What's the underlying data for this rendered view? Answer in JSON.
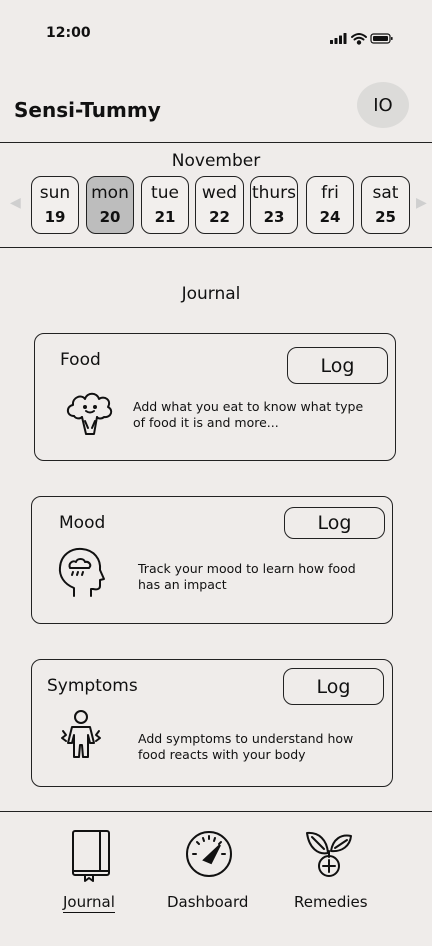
{
  "status": {
    "time": "12:00"
  },
  "header": {
    "title": "Sensi-Tummy",
    "avatar_initials": "IO"
  },
  "calendar": {
    "month": "November",
    "days": [
      {
        "name": "sun",
        "num": "19"
      },
      {
        "name": "mon",
        "num": "20"
      },
      {
        "name": "tue",
        "num": "21"
      },
      {
        "name": "wed",
        "num": "22"
      },
      {
        "name": "thurs",
        "num": "23"
      },
      {
        "name": "fri",
        "num": "24"
      },
      {
        "name": "sat",
        "num": "25"
      }
    ],
    "selected": "mon"
  },
  "journal": {
    "title": "Journal",
    "cards": [
      {
        "title": "Food",
        "button": "Log",
        "description": "Add what you eat to know what type of food it is and more...",
        "icon": "broccoli-icon"
      },
      {
        "title": "Mood",
        "button": "Log",
        "description": "Track your mood to learn how food has an impact",
        "icon": "head-cloud-icon"
      },
      {
        "title": "Symptoms",
        "button": "Log",
        "description": "Add symptoms to understand how food reacts with your body",
        "icon": "body-pain-icon"
      }
    ]
  },
  "nav": {
    "items": [
      {
        "label": "Journal",
        "icon": "book-icon",
        "active": true
      },
      {
        "label": "Dashboard",
        "icon": "gauge-icon",
        "active": false
      },
      {
        "label": "Remedies",
        "icon": "plant-plus-icon",
        "active": false
      }
    ]
  }
}
